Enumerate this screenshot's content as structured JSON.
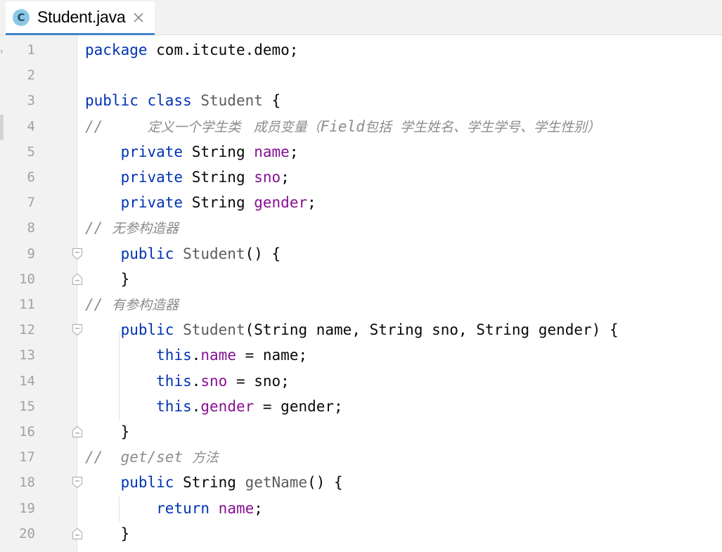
{
  "tab": {
    "icon_letter": "C",
    "file_name": "Student.java",
    "close_icon": "close-icon"
  },
  "lines": [
    {
      "n": "1",
      "tokens": [
        [
          "kw",
          "package"
        ],
        [
          "plain",
          " com.itcute.demo;"
        ]
      ]
    },
    {
      "n": "2",
      "tokens": []
    },
    {
      "n": "3",
      "tokens": [
        [
          "kw",
          "public class "
        ],
        [
          "cls",
          "Student"
        ],
        [
          "plain",
          " {"
        ]
      ]
    },
    {
      "n": "4",
      "tokens": [
        [
          "cmt",
          "//     "
        ],
        [
          "cmt-cn",
          "定义一个学生类   成员变量（"
        ],
        [
          "cmt",
          "Field"
        ],
        [
          "cmt-cn",
          "包括  学生姓名、学生学号、学生性别）"
        ]
      ]
    },
    {
      "n": "5",
      "tokens": [
        [
          "plain",
          "    "
        ],
        [
          "kw",
          "private"
        ],
        [
          "plain",
          " String "
        ],
        [
          "fld",
          "name"
        ],
        [
          "plain",
          ";"
        ]
      ]
    },
    {
      "n": "6",
      "tokens": [
        [
          "plain",
          "    "
        ],
        [
          "kw",
          "private"
        ],
        [
          "plain",
          " String "
        ],
        [
          "fld",
          "sno"
        ],
        [
          "plain",
          ";"
        ]
      ]
    },
    {
      "n": "7",
      "tokens": [
        [
          "plain",
          "    "
        ],
        [
          "kw",
          "private"
        ],
        [
          "plain",
          " String "
        ],
        [
          "fld",
          "gender"
        ],
        [
          "plain",
          ";"
        ]
      ]
    },
    {
      "n": "8",
      "tokens": [
        [
          "cmt",
          "// "
        ],
        [
          "cmt-cn",
          "无参构造器"
        ]
      ]
    },
    {
      "n": "9",
      "tokens": [
        [
          "plain",
          "    "
        ],
        [
          "kw",
          "public"
        ],
        [
          "plain",
          " "
        ],
        [
          "fn",
          "Student"
        ],
        [
          "plain",
          "() {"
        ]
      ]
    },
    {
      "n": "10",
      "tokens": [
        [
          "plain",
          "    }"
        ]
      ]
    },
    {
      "n": "11",
      "tokens": [
        [
          "cmt",
          "// "
        ],
        [
          "cmt-cn",
          "有参构造器"
        ]
      ]
    },
    {
      "n": "12",
      "tokens": [
        [
          "plain",
          "    "
        ],
        [
          "kw",
          "public"
        ],
        [
          "plain",
          " "
        ],
        [
          "fn",
          "Student"
        ],
        [
          "plain",
          "(String name, String sno, String gender) {"
        ]
      ]
    },
    {
      "n": "13",
      "tokens": [
        [
          "plain",
          "        "
        ],
        [
          "kw",
          "this"
        ],
        [
          "plain",
          "."
        ],
        [
          "fld",
          "name"
        ],
        [
          "plain",
          " = name;"
        ]
      ]
    },
    {
      "n": "14",
      "tokens": [
        [
          "plain",
          "        "
        ],
        [
          "kw",
          "this"
        ],
        [
          "plain",
          "."
        ],
        [
          "fld",
          "sno"
        ],
        [
          "plain",
          " = sno;"
        ]
      ]
    },
    {
      "n": "15",
      "tokens": [
        [
          "plain",
          "        "
        ],
        [
          "kw",
          "this"
        ],
        [
          "plain",
          "."
        ],
        [
          "fld",
          "gender"
        ],
        [
          "plain",
          " = gender;"
        ]
      ]
    },
    {
      "n": "16",
      "tokens": [
        [
          "plain",
          "    }"
        ]
      ]
    },
    {
      "n": "17",
      "tokens": [
        [
          "cmt",
          "//  get/set "
        ],
        [
          "cmt-cn",
          "方法"
        ]
      ]
    },
    {
      "n": "18",
      "tokens": [
        [
          "plain",
          "    "
        ],
        [
          "kw",
          "public"
        ],
        [
          "plain",
          " String "
        ],
        [
          "fn",
          "getName"
        ],
        [
          "plain",
          "() {"
        ]
      ]
    },
    {
      "n": "19",
      "tokens": [
        [
          "plain",
          "        "
        ],
        [
          "kw",
          "return"
        ],
        [
          "plain",
          " "
        ],
        [
          "fld",
          "name"
        ],
        [
          "plain",
          ";"
        ]
      ]
    },
    {
      "n": "20",
      "tokens": [
        [
          "plain",
          "    }"
        ]
      ]
    }
  ],
  "fold_markers": {
    "9": "open",
    "10": "close",
    "12": "open",
    "16": "close",
    "18": "open",
    "20": "close"
  },
  "colors": {
    "keyword": "#0033b3",
    "field": "#871094",
    "comment": "#8c8c8c",
    "class_name": "#5c5c5c",
    "text": "#080808",
    "tab_underline": "#4083c9"
  }
}
